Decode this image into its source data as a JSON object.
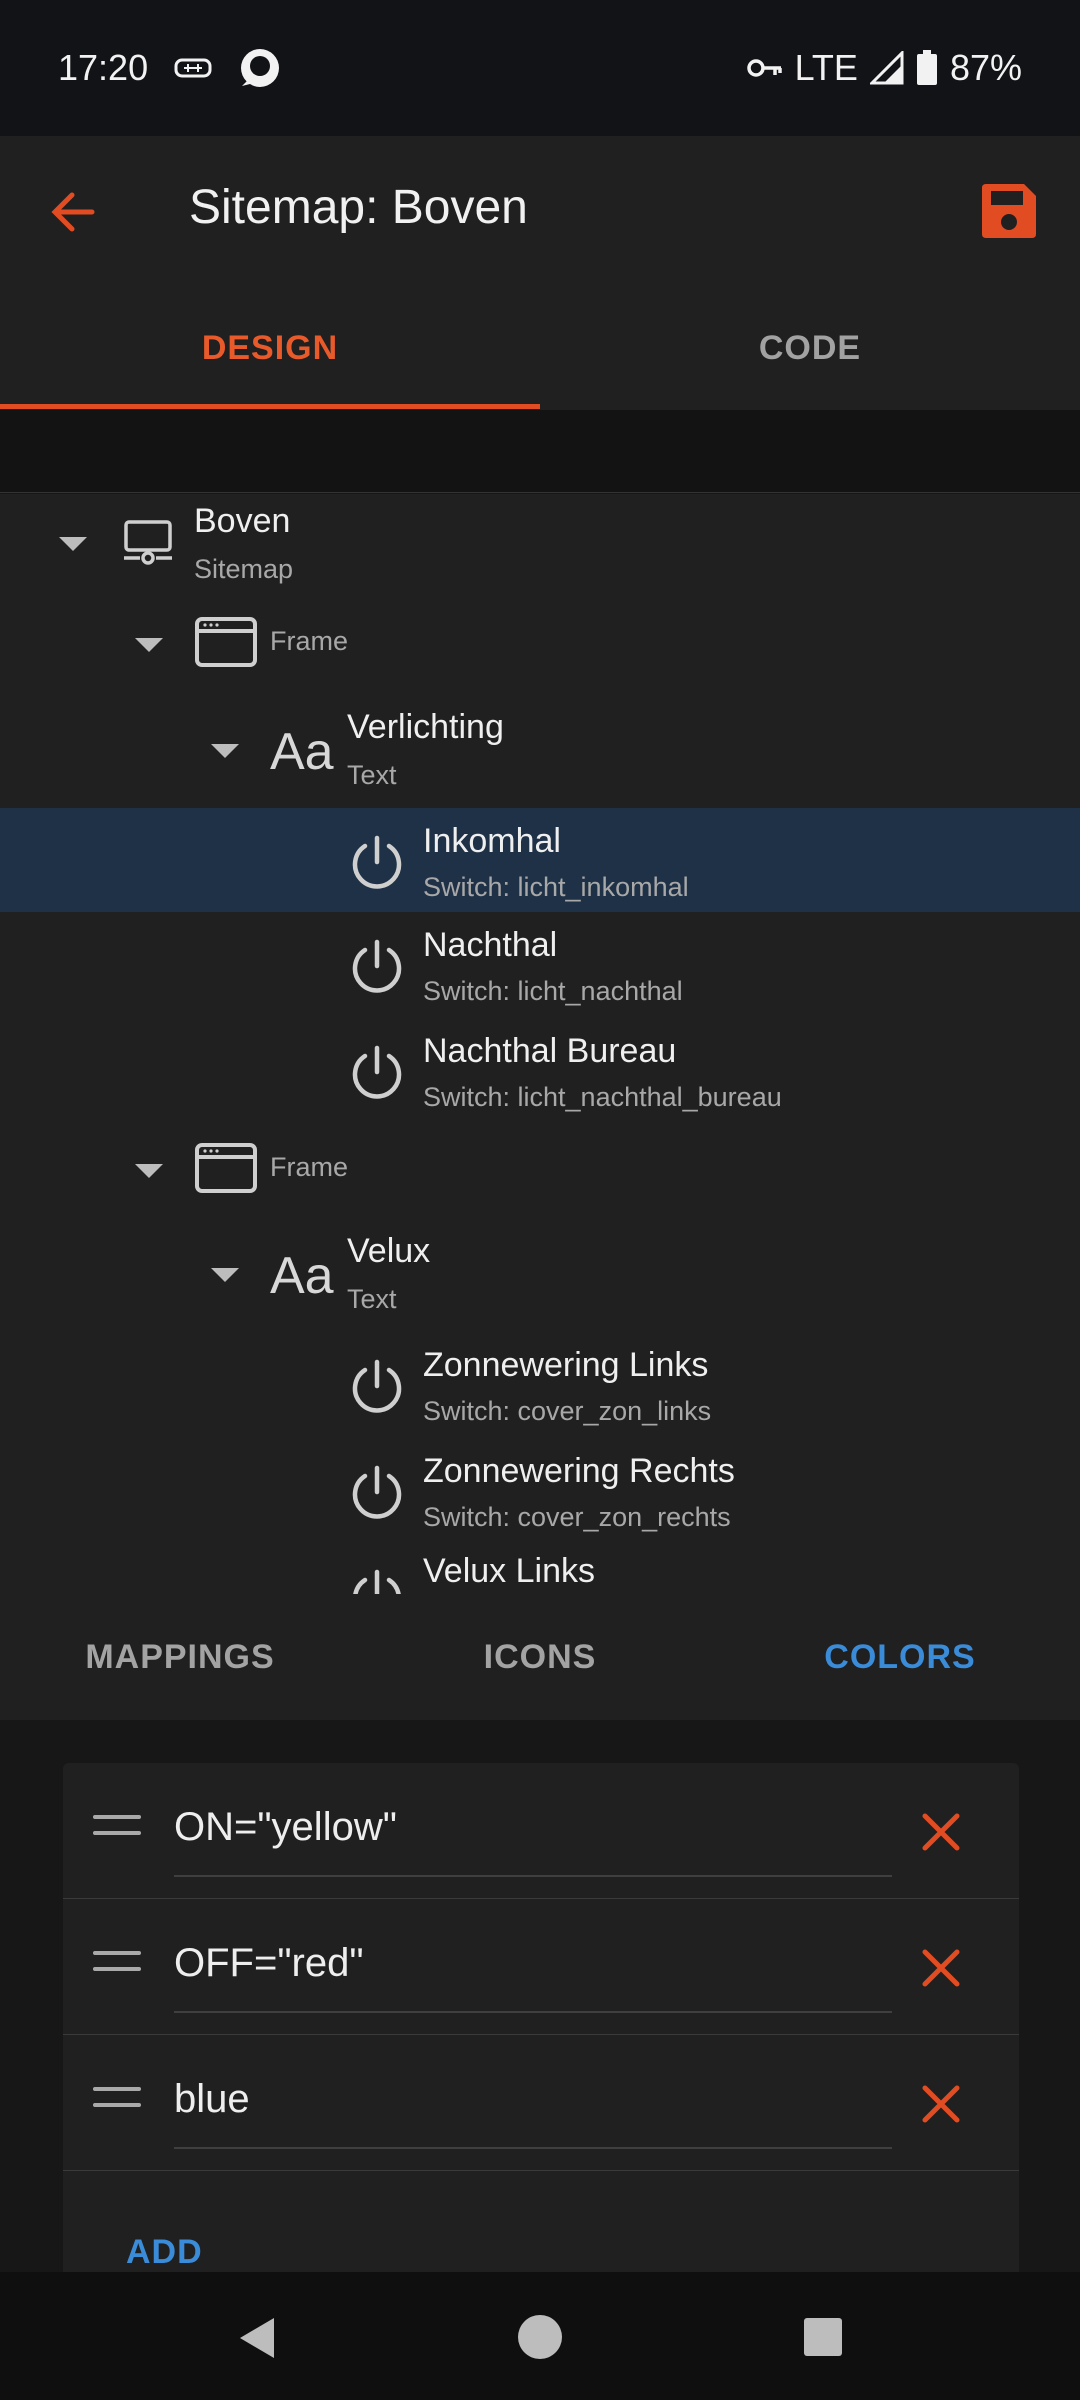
{
  "status": {
    "time": "17:20",
    "network": "LTE",
    "battery": "87%"
  },
  "appbar": {
    "title": "Sitemap: Boven"
  },
  "tabs": [
    {
      "label": "DESIGN",
      "active": true
    },
    {
      "label": "CODE",
      "active": false
    }
  ],
  "tree": {
    "root": {
      "title": "Boven",
      "subtitle": "Sitemap"
    },
    "frame1": {
      "label": "Frame"
    },
    "text1": {
      "title": "Verlichting",
      "subtitle": "Text"
    },
    "items1": [
      {
        "title": "Inkomhal",
        "subtitle": "Switch: licht_inkomhal",
        "selected": true
      },
      {
        "title": "Nachthal",
        "subtitle": "Switch: licht_nachthal"
      },
      {
        "title": "Nachthal Bureau",
        "subtitle": "Switch: licht_nachthal_bureau"
      }
    ],
    "frame2": {
      "label": "Frame"
    },
    "text2": {
      "title": "Velux",
      "subtitle": "Text"
    },
    "items2": [
      {
        "title": "Zonnewering Links",
        "subtitle": "Switch: cover_zon_links"
      },
      {
        "title": "Zonnewering Rechts",
        "subtitle": "Switch: cover_zon_rechts"
      },
      {
        "title": "Velux Links",
        "subtitle": ""
      }
    ]
  },
  "subtabs": [
    {
      "label": "MAPPINGS",
      "active": false
    },
    {
      "label": "ICONS",
      "active": false
    },
    {
      "label": "COLORS",
      "active": true
    }
  ],
  "colors": {
    "rows": [
      "ON=\"yellow\"",
      "OFF=\"red\"",
      "blue"
    ],
    "add_label": "ADD"
  },
  "theme": {
    "accent": "#e24c23",
    "link": "#3a8bd8",
    "selected_row": "#1e3147"
  },
  "icons": {
    "back": "arrow-left-icon",
    "save": "floppy-disk-icon",
    "sitemap": "sitemap-icon",
    "frame": "frame-icon",
    "text": "text-aa-icon",
    "switch": "power-icon",
    "drag": "drag-handle-icon",
    "delete": "close-x-icon"
  }
}
